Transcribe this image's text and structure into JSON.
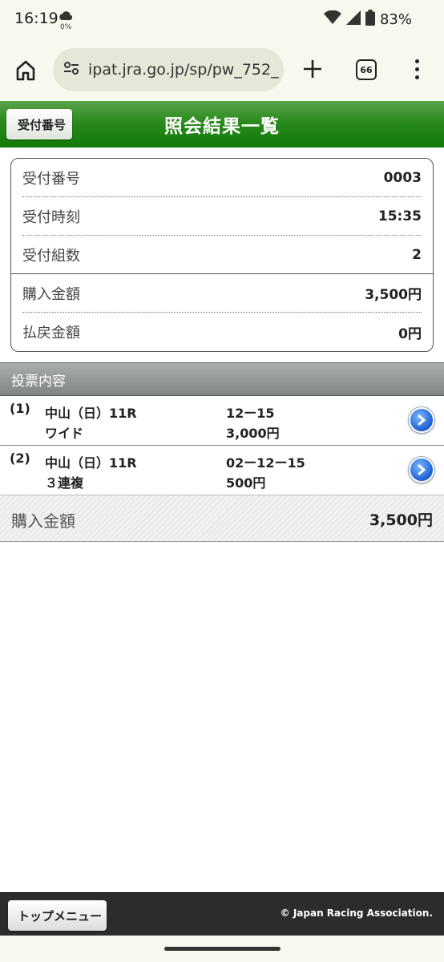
{
  "status_bar": {
    "time": "16:19",
    "weather_text": "0%",
    "battery": "83%"
  },
  "browser": {
    "url": "ipat.jra.go.jp/sp/pw_752_",
    "tab_count": "66"
  },
  "header": {
    "back_label": "受付番号",
    "title": "照会結果一覧",
    "color": "#1d7d10"
  },
  "info": {
    "rows": [
      {
        "label": "受付番号",
        "value": "0003"
      },
      {
        "label": "受付時刻",
        "value": "15:35"
      },
      {
        "label": "受付組数",
        "value": "2"
      },
      {
        "label": "購入金額",
        "value": "3,500円"
      },
      {
        "label": "払戻金額",
        "value": "0円"
      }
    ]
  },
  "section": {
    "title": "投票内容"
  },
  "bets": [
    {
      "num": "(1)",
      "race": "中山（日）11R",
      "type": "ワイド",
      "numbers": "12ー15",
      "amount": "3,000円"
    },
    {
      "num": "(2)",
      "race": "中山（日）11R",
      "type": "３連複",
      "numbers": "02ー12ー15",
      "amount": "500円"
    }
  ],
  "total": {
    "label": "購入金額",
    "value": "3,500円"
  },
  "footer": {
    "top_menu_label": "トップメニュー",
    "copyright": "© Japan Racing Association."
  }
}
